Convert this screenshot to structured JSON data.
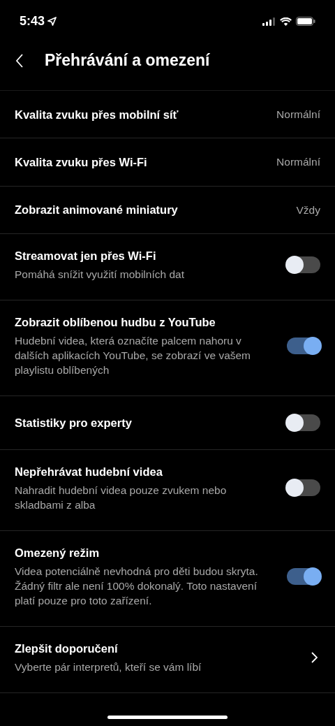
{
  "status_bar": {
    "time": "5:43"
  },
  "header": {
    "title": "Přehrávání a omezení"
  },
  "settings": [
    {
      "kind": "value",
      "title": "Kvalita zvuku přes mobilní síť",
      "value": "Normální"
    },
    {
      "kind": "value",
      "title": "Kvalita zvuku přes Wi-Fi",
      "value": "Normální"
    },
    {
      "kind": "value",
      "title": "Zobrazit animované miniatury",
      "value": "Vždy"
    },
    {
      "kind": "toggle",
      "title": "Streamovat jen přes Wi-Fi",
      "description": "Pomáhá snížit využití mobilních dat",
      "on": false
    },
    {
      "kind": "toggle",
      "title": "Zobrazit oblíbenou hudbu z YouTube",
      "description": "Hudební videa, která označíte palcem nahoru v dalších aplikacích YouTube, se zobrazí ve vašem playlistu oblíbených",
      "on": true
    },
    {
      "kind": "toggle",
      "title": "Statistiky pro experty",
      "on": false
    },
    {
      "kind": "toggle",
      "title": "Nepřehrávat hudební videa",
      "description": "Nahradit hudební videa pouze zvukem nebo skladbami z alba",
      "on": false
    },
    {
      "kind": "toggle",
      "title": "Omezený režim",
      "description": "Videa potenciálně nevhodná pro děti budou skryta. Žádný filtr ale není 100% dokonalý. Toto nastavení platí pouze pro toto zařízení.",
      "on": true
    },
    {
      "kind": "link",
      "title": "Zlepšit doporučení",
      "description": "Vyberte pár interpretů, kteří se vám líbí"
    }
  ]
}
